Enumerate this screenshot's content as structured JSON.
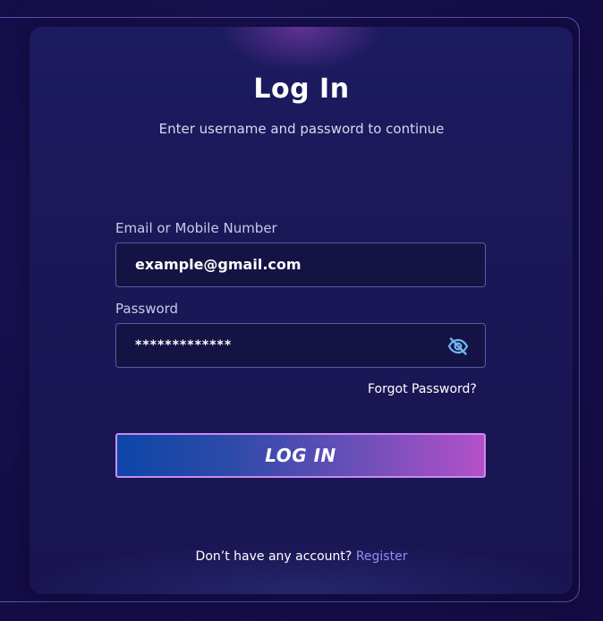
{
  "header": {
    "title": "Log In",
    "subtitle": "Enter username and password to continue"
  },
  "form": {
    "email_label": "Email or Mobile Number",
    "email_value": "example@gmail.com",
    "password_label": "Password",
    "password_value": "*************",
    "password_toggle_icon": "eye-off-icon",
    "forgot_password": "Forgot Password?",
    "submit_label": "LOG IN"
  },
  "footer": {
    "prompt": "Don’t have any account?",
    "register_link": "Register"
  },
  "colors": {
    "background": "#160f4a",
    "card": "#1b1756",
    "field_border": "#5a5aa8",
    "button_start": "#0c46a8",
    "button_end": "#b450c8",
    "link": "#8f8ff0",
    "eye_icon": "#6fb6f2"
  }
}
